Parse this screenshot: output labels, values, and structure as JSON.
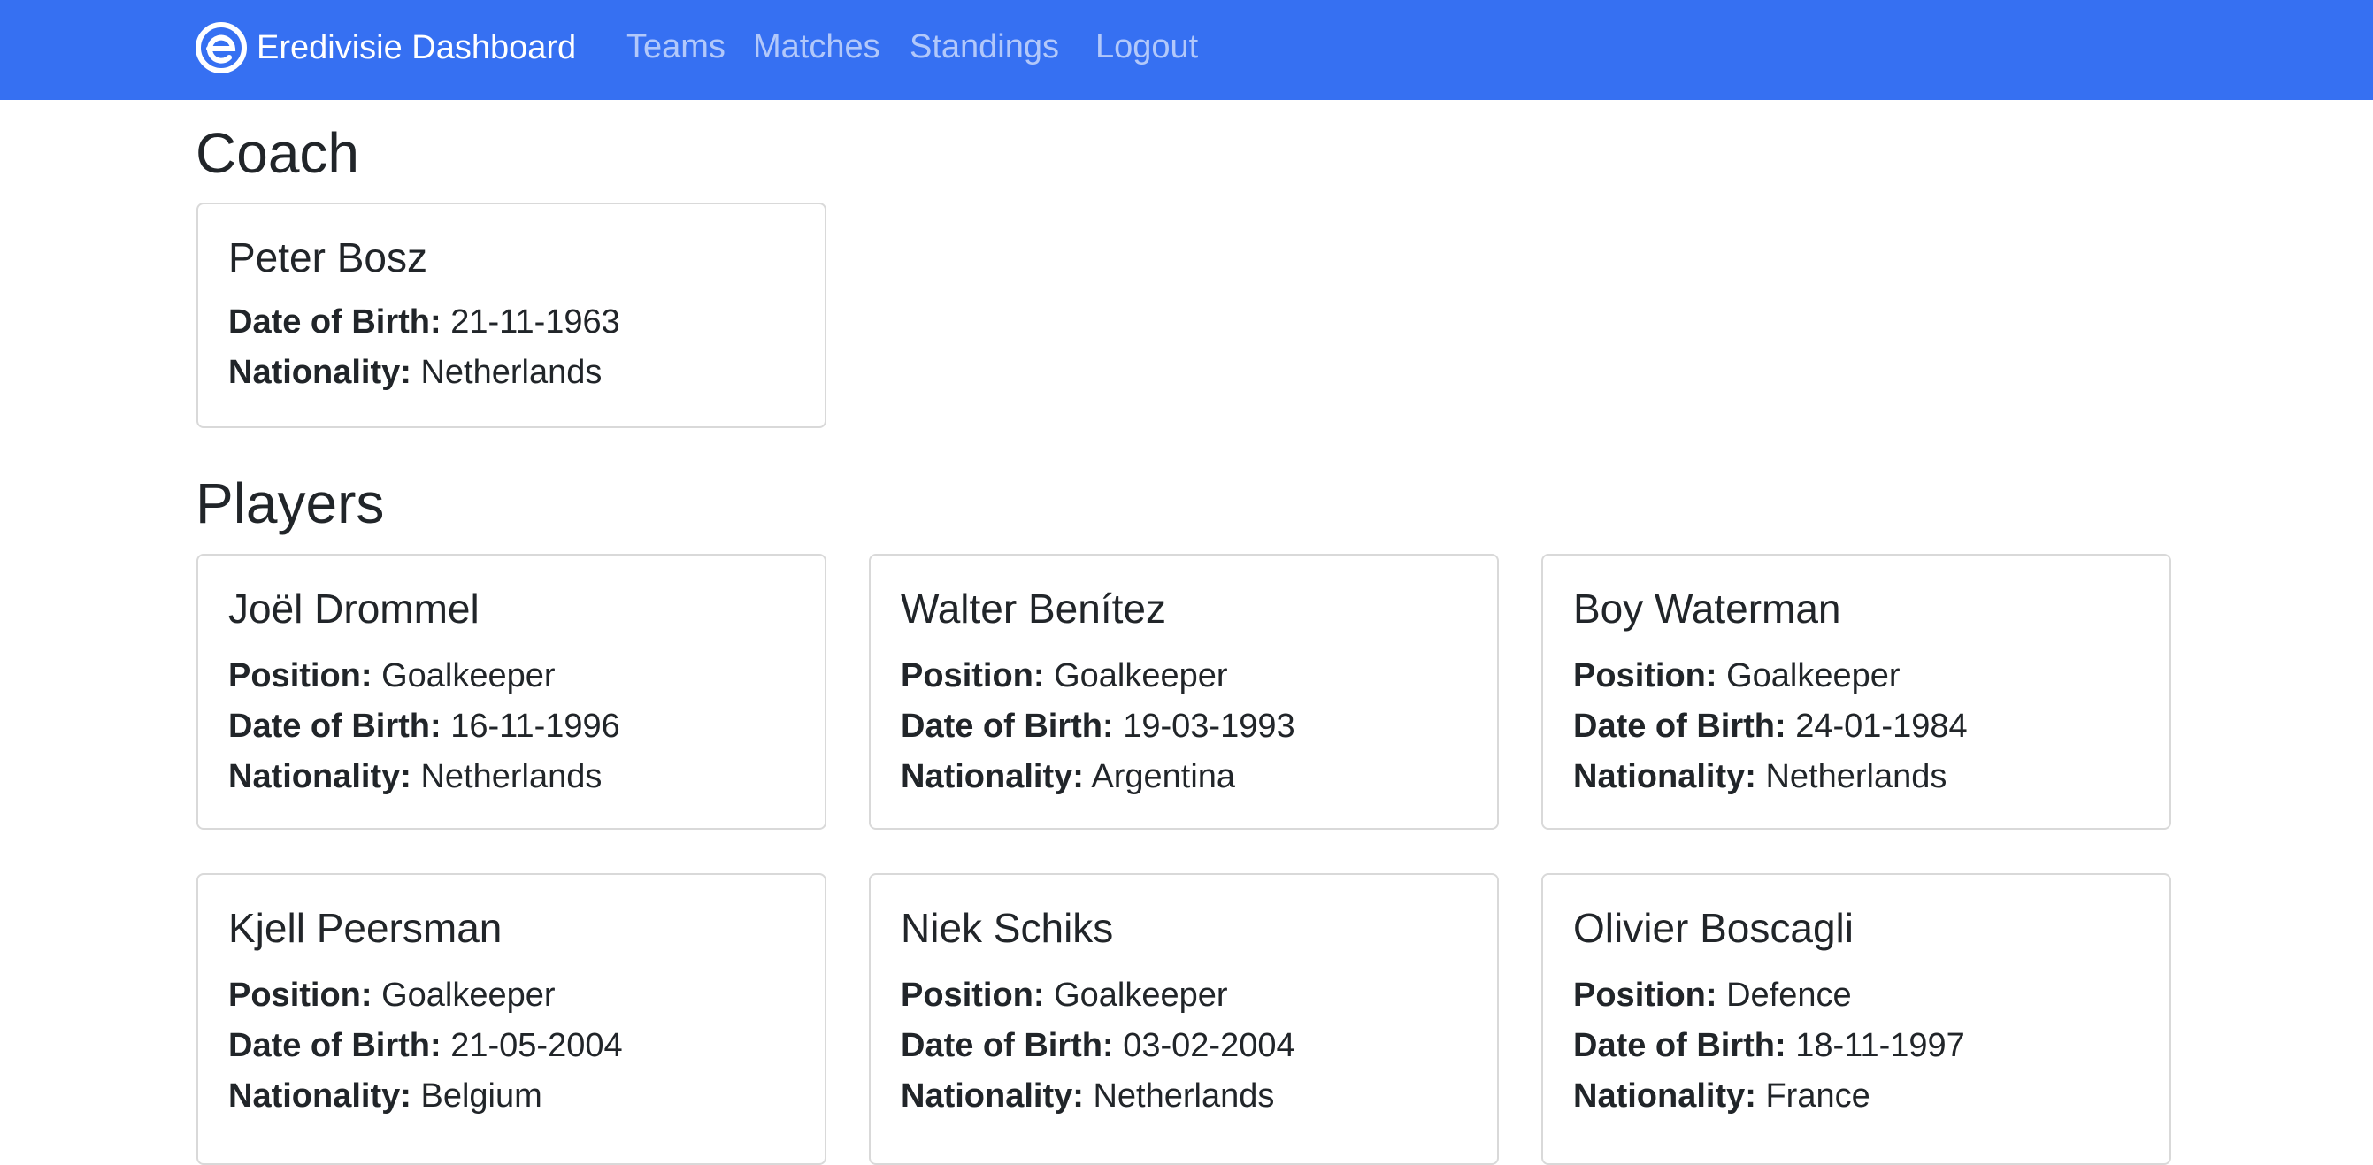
{
  "navbar": {
    "brand": "Eredivisie Dashboard",
    "links": [
      "Teams",
      "Matches",
      "Standings",
      "Logout"
    ]
  },
  "colors": {
    "navbar": "#3670f2",
    "text": "#212529",
    "card_border": "#d9d9d9"
  },
  "icons": {
    "brand_logo": "eredivisie-logo-icon"
  },
  "labels": {
    "position": "Position:",
    "dob": "Date of Birth:",
    "nationality": "Nationality:"
  },
  "coach_section": {
    "title": "Coach",
    "coach": {
      "name": "Peter Bosz",
      "dob": "21-11-1963",
      "nationality": "Netherlands"
    }
  },
  "players_section": {
    "title": "Players",
    "players": [
      {
        "name": "Joël Drommel",
        "position": "Goalkeeper",
        "dob": "16-11-1996",
        "nationality": "Netherlands"
      },
      {
        "name": "Walter Benítez",
        "position": "Goalkeeper",
        "dob": "19-03-1993",
        "nationality": "Argentina"
      },
      {
        "name": "Boy Waterman",
        "position": "Goalkeeper",
        "dob": "24-01-1984",
        "nationality": "Netherlands"
      },
      {
        "name": "Kjell Peersman",
        "position": "Goalkeeper",
        "dob": "21-05-2004",
        "nationality": "Belgium"
      },
      {
        "name": "Niek Schiks",
        "position": "Goalkeeper",
        "dob": "03-02-2004",
        "nationality": "Netherlands"
      },
      {
        "name": "Olivier Boscagli",
        "position": "Defence",
        "dob": "18-11-1997",
        "nationality": "France"
      }
    ]
  }
}
